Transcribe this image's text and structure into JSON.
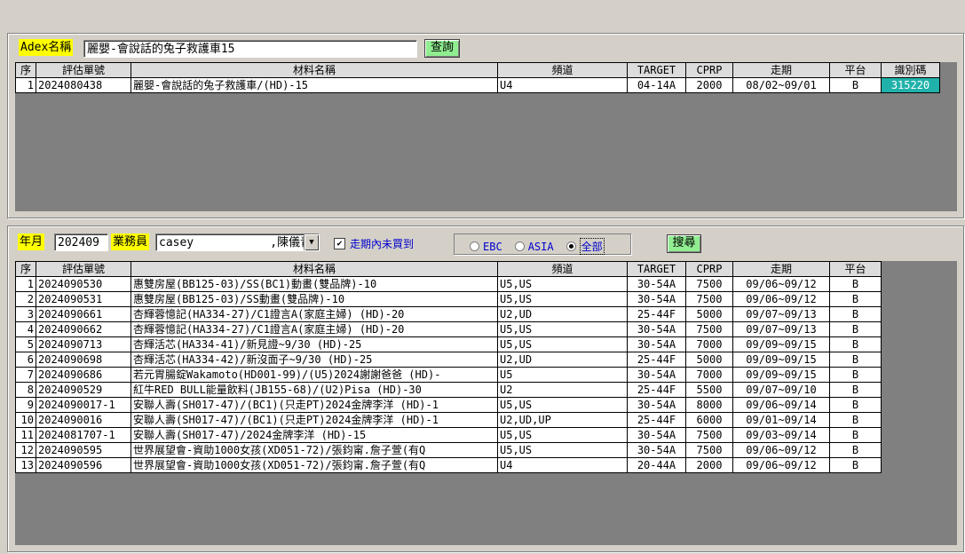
{
  "top": {
    "adex_label": "Adex名稱",
    "adex_value": "麗嬰-會說話的兔子救護車15",
    "query_button": "查詢",
    "table": {
      "headers": [
        "序",
        "評估單號",
        "材料名稱",
        "頻道",
        "TARGET",
        "CPRP",
        "走期",
        "平台",
        "識別碼"
      ],
      "rows": [
        [
          "1",
          "2024080438",
          "麗嬰-會說話的兔子救護車/(HD)-15",
          "U4",
          "04-14A",
          "2000",
          "08/02~09/01",
          "B",
          "315220"
        ]
      ]
    }
  },
  "bottom": {
    "month_label": "年月",
    "month_value": "202409",
    "sales_label": "業務員",
    "sales_value": "casey           ,陳儀青",
    "checkbox_label": "走期內未買到",
    "checkbox_checked": true,
    "radios": [
      {
        "label": "EBC",
        "selected": false
      },
      {
        "label": "ASIA",
        "selected": false
      },
      {
        "label": "全部",
        "selected": true
      }
    ],
    "search_button": "搜尋",
    "table": {
      "headers": [
        "序",
        "評估單號",
        "材料名稱",
        "頻道",
        "TARGET",
        "CPRP",
        "走期",
        "平台"
      ],
      "rows": [
        [
          "1",
          "2024090530",
          "惠雙房屋(BB125-03)/SS(BC1)動畫(雙品牌)-10",
          "U5,US",
          "30-54A",
          "7500",
          "09/06~09/12",
          "B"
        ],
        [
          "2",
          "2024090531",
          "惠雙房屋(BB125-03)/SS動畫(雙品牌)-10",
          "U5,US",
          "30-54A",
          "7500",
          "09/06~09/12",
          "B"
        ],
        [
          "3",
          "2024090661",
          "杏輝蓉憶記(HA334-27)/C1證言A(家庭主婦) (HD)-20",
          "U2,UD",
          "25-44F",
          "5000",
          "09/07~09/13",
          "B"
        ],
        [
          "4",
          "2024090662",
          "杏輝蓉憶記(HA334-27)/C1證言A(家庭主婦) (HD)-20",
          "U5,US",
          "30-54A",
          "7500",
          "09/07~09/13",
          "B"
        ],
        [
          "5",
          "2024090713",
          "杏輝活芯(HA334-41)/新見證~9/30 (HD)-25",
          "U5,US",
          "30-54A",
          "7000",
          "09/09~09/15",
          "B"
        ],
        [
          "6",
          "2024090698",
          "杏輝活芯(HA334-42)/新沒面子~9/30 (HD)-25",
          "U2,UD",
          "25-44F",
          "5000",
          "09/09~09/15",
          "B"
        ],
        [
          "7",
          "2024090686",
          "若元胃腸錠Wakamoto(HD001-99)/(U5)2024謝謝爸爸 (HD)-",
          "U5",
          "30-54A",
          "7000",
          "09/09~09/15",
          "B"
        ],
        [
          "8",
          "2024090529",
          "紅牛RED BULL能量飲料(JB155-68)/(U2)Pisa (HD)-30",
          "U2",
          "25-44F",
          "5500",
          "09/07~09/10",
          "B"
        ],
        [
          "9",
          "2024090017-1",
          "安聯人壽(SH017-47)/(BC1)(只走PT)2024金牌李洋 (HD)-1",
          "U5,US",
          "30-54A",
          "8000",
          "09/06~09/14",
          "B"
        ],
        [
          "10",
          "2024090016",
          "安聯人壽(SH017-47)/(BC1)(只走PT)2024金牌李洋 (HD)-1",
          "U2,UD,UP",
          "25-44F",
          "6000",
          "09/01~09/14",
          "B"
        ],
        [
          "11",
          "2024081707-1",
          "安聯人壽(SH017-47)/2024金牌李洋 (HD)-15",
          "U5,US",
          "30-54A",
          "7500",
          "09/03~09/14",
          "B"
        ],
        [
          "12",
          "2024090595",
          "世界展望會-資助1000女孩(XD051-72)/張鈞甯.詹子萱(有Q",
          "U5,US",
          "30-54A",
          "7500",
          "09/06~09/12",
          "B"
        ],
        [
          "13",
          "2024090596",
          "世界展望會-資助1000女孩(XD051-72)/張鈞甯.詹子萱(有Q",
          "U4",
          "20-44A",
          "2000",
          "09/06~09/12",
          "B"
        ]
      ]
    }
  }
}
